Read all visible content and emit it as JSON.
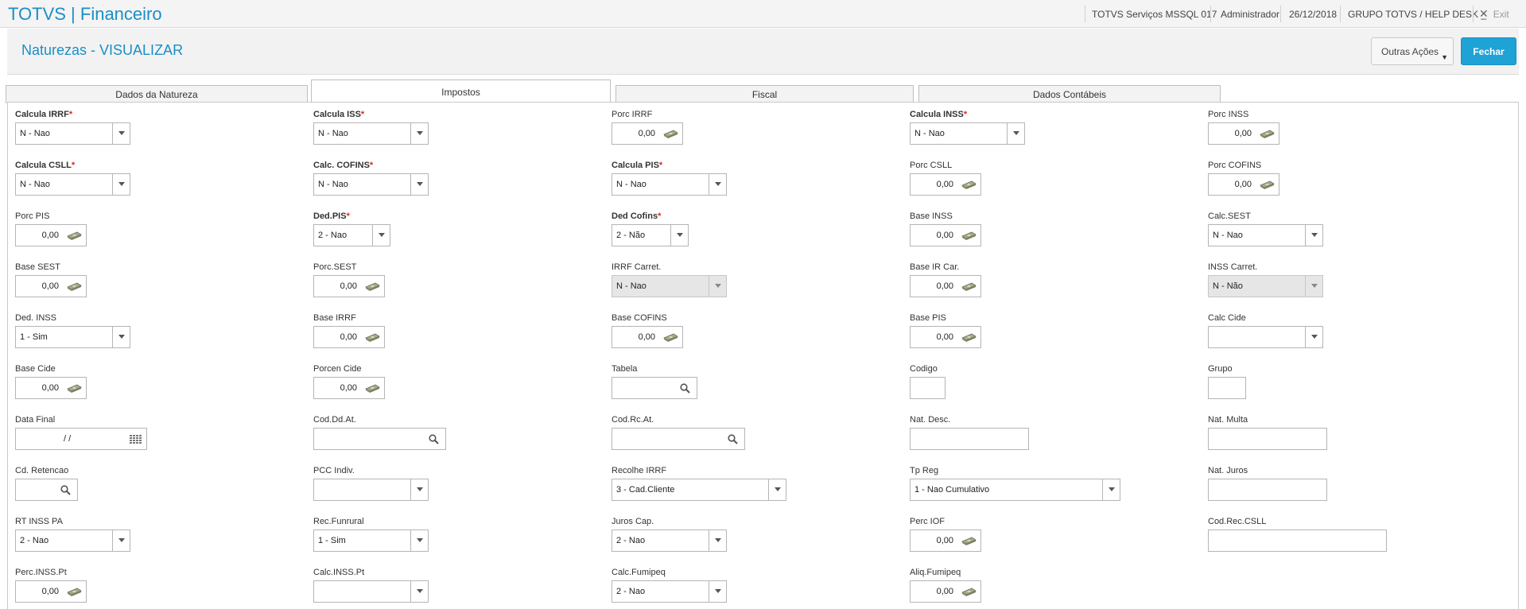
{
  "app": {
    "title": "TOTVS | Financeiro"
  },
  "topbar": {
    "environment": "TOTVS Serviços MSSQL 017",
    "user": "Administrador",
    "date": "26/12/2018",
    "company": "GRUPO TOTVS / HELP DESK _",
    "exit_label": "Exit"
  },
  "header": {
    "title": "Naturezas - VISUALIZAR",
    "outras_acoes": "Outras Ações",
    "fechar": "Fechar"
  },
  "tabs": [
    {
      "label": "Dados da Natureza",
      "active": false
    },
    {
      "label": "Impostos",
      "active": true
    },
    {
      "label": "Fiscal",
      "active": false
    },
    {
      "label": "Dados Contábeis",
      "active": false
    }
  ],
  "fields": {
    "calcula_irrf": {
      "label": "Calcula IRRF",
      "value": "N - Nao"
    },
    "calcula_iss": {
      "label": "Calcula ISS",
      "value": "N - Nao"
    },
    "porc_irrf": {
      "label": "Porc IRRF",
      "value": "0,00"
    },
    "calcula_inss": {
      "label": "Calcula INSS",
      "value": "N - Nao"
    },
    "porc_inss": {
      "label": "Porc INSS",
      "value": "0,00"
    },
    "calcula_csll": {
      "label": "Calcula CSLL",
      "value": "N - Nao"
    },
    "calc_cofins": {
      "label": "Calc. COFINS",
      "value": "N - Nao"
    },
    "calcula_pis": {
      "label": "Calcula PIS",
      "value": "N - Nao"
    },
    "porc_csll": {
      "label": "Porc CSLL",
      "value": "0,00"
    },
    "porc_cofins": {
      "label": "Porc COFINS",
      "value": "0,00"
    },
    "porc_pis": {
      "label": "Porc PIS",
      "value": "0,00"
    },
    "ded_pis": {
      "label": "Ded.PIS",
      "value": "2 - Nao"
    },
    "ded_cofins": {
      "label": "Ded Cofins",
      "value": "2 - Não"
    },
    "base_inss": {
      "label": "Base INSS",
      "value": "0,00"
    },
    "calc_sest": {
      "label": "Calc.SEST",
      "value": "N - Nao"
    },
    "base_sest": {
      "label": "Base SEST",
      "value": "0,00"
    },
    "porc_sest": {
      "label": "Porc.SEST",
      "value": "0,00"
    },
    "irrf_carret": {
      "label": "IRRF Carret.",
      "value": "N - Nao"
    },
    "base_ir_car": {
      "label": "Base IR Car.",
      "value": "0,00"
    },
    "inss_carret": {
      "label": "INSS Carret.",
      "value": "N - Não"
    },
    "ded_inss": {
      "label": "Ded. INSS",
      "value": "1 - Sim"
    },
    "base_irrf": {
      "label": "Base IRRF",
      "value": "0,00"
    },
    "base_cofins": {
      "label": "Base COFINS",
      "value": "0,00"
    },
    "base_pis": {
      "label": "Base PIS",
      "value": "0,00"
    },
    "calc_cide": {
      "label": "Calc Cide",
      "value": ""
    },
    "base_cide": {
      "label": "Base Cide",
      "value": "0,00"
    },
    "porcen_cide": {
      "label": "Porcen Cide",
      "value": "0,00"
    },
    "tabela": {
      "label": "Tabela",
      "value": ""
    },
    "codigo": {
      "label": "Codigo",
      "value": ""
    },
    "grupo": {
      "label": "Grupo",
      "value": ""
    },
    "data_final": {
      "label": "Data Final",
      "value": "/ /"
    },
    "cod_dd_at": {
      "label": "Cod.Dd.At.",
      "value": ""
    },
    "cod_rc_at": {
      "label": "Cod.Rc.At.",
      "value": ""
    },
    "nat_desc": {
      "label": "Nat. Desc.",
      "value": ""
    },
    "nat_multa": {
      "label": "Nat. Multa",
      "value": ""
    },
    "cd_retencao": {
      "label": "Cd. Retencao",
      "value": ""
    },
    "pcc_indiv": {
      "label": "PCC Indiv.",
      "value": ""
    },
    "recolhe_irrf": {
      "label": "Recolhe IRRF",
      "value": "3 - Cad.Cliente"
    },
    "tp_reg": {
      "label": "Tp Reg",
      "value": "1 - Nao Cumulativo"
    },
    "nat_juros": {
      "label": "Nat. Juros",
      "value": ""
    },
    "rt_inss_pa": {
      "label": "RT INSS PA",
      "value": "2 - Nao"
    },
    "rec_funrural": {
      "label": "Rec.Funrural",
      "value": "1 - Sim"
    },
    "juros_cap": {
      "label": "Juros Cap.",
      "value": "2 - Nao"
    },
    "perc_iof": {
      "label": "Perc IOF",
      "value": "0,00"
    },
    "cod_rec_csll": {
      "label": "Cod.Rec.CSLL",
      "value": ""
    },
    "perc_inss_pt": {
      "label": "Perc.INSS.Pt",
      "value": "0,00"
    },
    "calc_inss_pt": {
      "label": "Calc.INSS.Pt",
      "value": ""
    },
    "calc_fumipeq": {
      "label": "Calc.Fumipeq",
      "value": "2 - Nao"
    },
    "aliq_fumipeq": {
      "label": "Aliq.Fumipeq",
      "value": "0,00"
    }
  }
}
